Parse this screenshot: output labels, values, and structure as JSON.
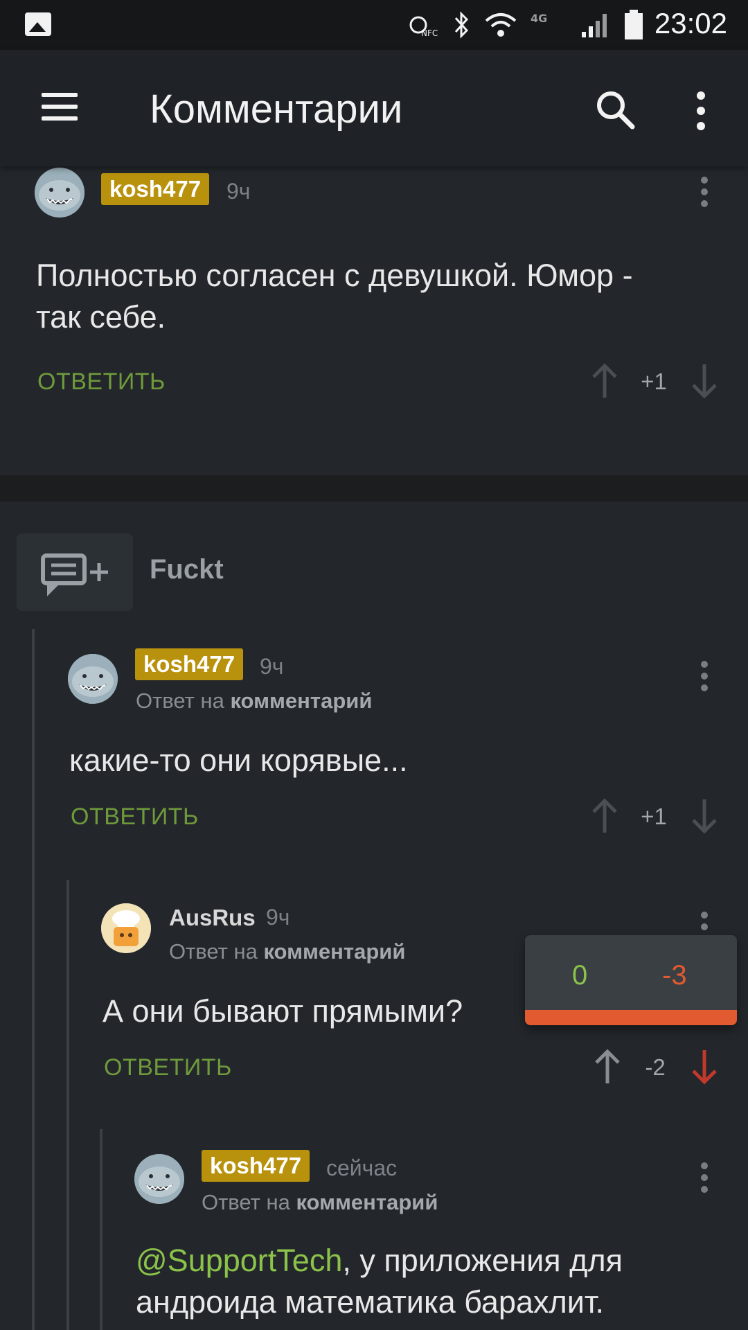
{
  "status_bar": {
    "time": "23:02",
    "icons": [
      "gallery-notification-icon",
      "nfc-icon",
      "bluetooth-icon",
      "wifi-icon",
      "4g-icon",
      "signal-icon",
      "battery-icon"
    ]
  },
  "app_bar": {
    "title": "Комментарии",
    "icons": [
      "menu-icon",
      "search-icon",
      "more-vert-icon"
    ]
  },
  "post": {
    "title": "Fuckt"
  },
  "comments": [
    {
      "author": "kosh477",
      "author_badge": true,
      "time": "9ч",
      "reply_prefix": "",
      "reply_target": "",
      "text_line1": "Полностью согласен с девушкой. Юмор -",
      "text_line2": "так себе.",
      "reply_label": "ОТВЕТИТЬ",
      "score": "+1"
    },
    {
      "author": "kosh477",
      "author_badge": true,
      "time": "9ч",
      "reply_prefix": "Ответ на ",
      "reply_target": "комментарий",
      "text_line1": "какие-то они корявые...",
      "reply_label": "ОТВЕТИТЬ",
      "score": "+1"
    },
    {
      "author": "AusRus",
      "author_badge": false,
      "time": "9ч",
      "reply_prefix": "Ответ на ",
      "reply_target": "комментарий",
      "text_line1": "А они бывают прямыми?",
      "reply_label": "ОТВЕТИТЬ",
      "score": "-2",
      "vote_popup": {
        "plus": "0",
        "minus": "-3"
      }
    },
    {
      "author": "kosh477",
      "author_badge": true,
      "time": "сейчас",
      "reply_prefix": "Ответ на ",
      "reply_target": "комментарий",
      "mention": "@SupportTech",
      "text_line1_rest": ", у приложения для",
      "text_line2": "андроида математика барахлит."
    }
  ],
  "colors": {
    "background": "#23272b",
    "app_bar": "#1f2327",
    "badge": "#b8910d",
    "reply_green": "#6f9a3b",
    "downvote_red": "#c0392b",
    "popup_red": "#e25a2f"
  }
}
